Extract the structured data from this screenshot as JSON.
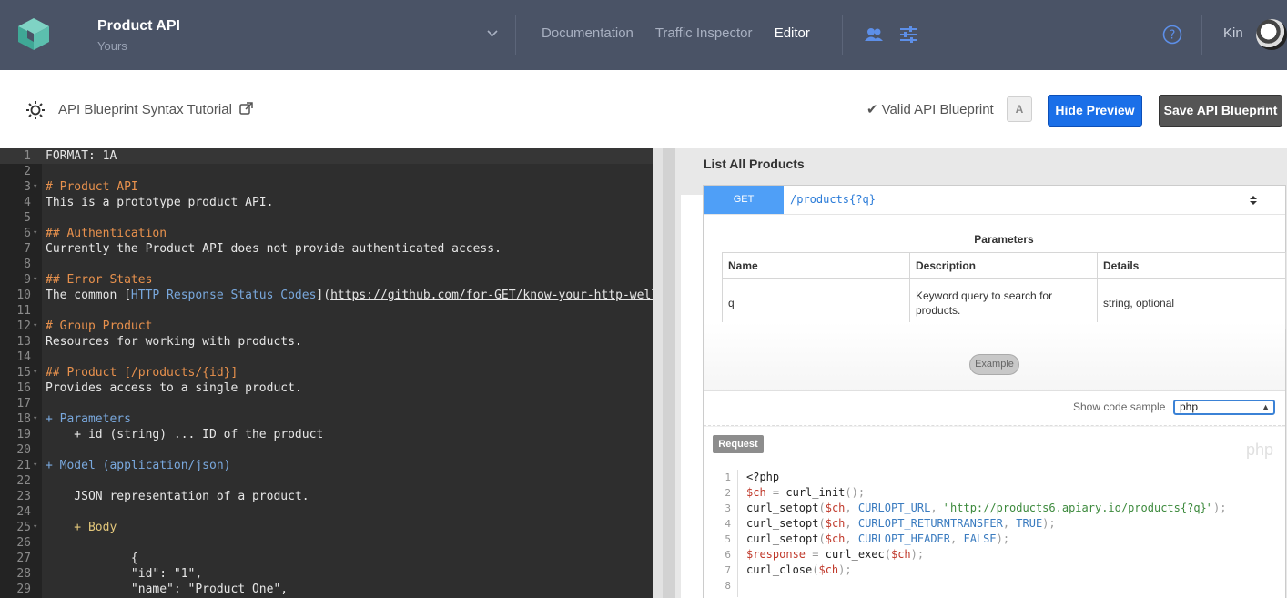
{
  "topnav": {
    "project_name": "Product API",
    "project_sub": "Yours",
    "links": [
      "Documentation",
      "Traffic Inspector",
      "Editor"
    ],
    "active_link": "Editor",
    "user_name": "Kin",
    "bg_color": "#4a5366"
  },
  "toolbar": {
    "tutorial_label": "API Blueprint Syntax Tutorial",
    "valid_label": "Valid API Blueprint",
    "a_label": "A",
    "hide_preview_label": "Hide Preview",
    "save_label": "Save API Blueprint",
    "primary_color": "#1a6fe8"
  },
  "editor": {
    "lines": [
      {
        "n": "1",
        "text": "FORMAT: 1A",
        "cls": ""
      },
      {
        "n": "2",
        "text": "",
        "cls": ""
      },
      {
        "n": "3",
        "text": "# Product API",
        "cls": "c-h",
        "fold": true
      },
      {
        "n": "4",
        "text": "This is a prototype product API.",
        "cls": ""
      },
      {
        "n": "5",
        "text": "",
        "cls": ""
      },
      {
        "n": "6",
        "text": "## Authentication",
        "cls": "c-h",
        "fold": true
      },
      {
        "n": "7",
        "text": "Currently the Product API does not provide authenticated access.",
        "cls": ""
      },
      {
        "n": "8",
        "text": "",
        "cls": ""
      },
      {
        "n": "9",
        "text": "## Error States",
        "cls": "c-h",
        "fold": true
      },
      {
        "n": "10",
        "text": "",
        "cls": "",
        "link": true
      },
      {
        "n": "11",
        "text": "",
        "cls": ""
      },
      {
        "n": "12",
        "text": "# Group Product",
        "cls": "c-h",
        "fold": true
      },
      {
        "n": "13",
        "text": "Resources for working with products.",
        "cls": ""
      },
      {
        "n": "14",
        "text": "",
        "cls": ""
      },
      {
        "n": "15",
        "text": "## Product [/products/{id}]",
        "cls": "c-h",
        "fold": true
      },
      {
        "n": "16",
        "text": "Provides access to a single product.",
        "cls": ""
      },
      {
        "n": "17",
        "text": "",
        "cls": ""
      },
      {
        "n": "18",
        "text": "+ Parameters",
        "cls": "c-b",
        "fold": true
      },
      {
        "n": "19",
        "text": "    + id (string) ... ID of the product",
        "cls": ""
      },
      {
        "n": "20",
        "text": "",
        "cls": ""
      },
      {
        "n": "21",
        "text": "+ Model (application/json)",
        "cls": "c-b",
        "fold": true
      },
      {
        "n": "22",
        "text": "",
        "cls": ""
      },
      {
        "n": "23",
        "text": "    JSON representation of a product.",
        "cls": ""
      },
      {
        "n": "24",
        "text": "",
        "cls": ""
      },
      {
        "n": "25",
        "text": "    + Body",
        "cls": "c-y",
        "fold": true
      },
      {
        "n": "26",
        "text": "",
        "cls": ""
      },
      {
        "n": "27",
        "text": "            {",
        "cls": ""
      },
      {
        "n": "28",
        "text": "            \"id\": \"1\",",
        "cls": ""
      },
      {
        "n": "29",
        "text": "            \"name\": \"Product One\",",
        "cls": ""
      }
    ],
    "line10": {
      "prefix": "The common [",
      "link_text": "HTTP Response Status Codes",
      "mid": "](",
      "url": "https://github.com/for-GET/know-your-http-well"
    }
  },
  "preview": {
    "title": "List All Products",
    "method": "GET",
    "path": "/products{?q}",
    "params_heading": "Parameters",
    "params_columns": [
      "Name",
      "Description",
      "Details"
    ],
    "params_rows": [
      [
        "q",
        "Keyword query to search for products.",
        "string, optional"
      ]
    ],
    "example_label": "Example",
    "sample_label": "Show code sample",
    "sample_value": "php",
    "request_label": "Request",
    "lang_watermark": "php",
    "method_color": "#4f9ff7"
  },
  "snippet": {
    "line_numbers": [
      "1",
      "2",
      "3",
      "4",
      "5",
      "6",
      "7",
      "8"
    ],
    "l1": "<?php",
    "l2_var": "$ch",
    "l2_op": " = ",
    "l2_fn": "curl_init",
    "l2_p": "();",
    "l3_fn": "curl_setopt",
    "l3_const": "CURLOPT_URL",
    "l3_str": "\"http://products6.apiary.io/products{?q}\"",
    "l4_const": "CURLOPT_RETURNTRANSFER",
    "l4_val": "TRUE",
    "l5_const": "CURLOPT_HEADER",
    "l5_val": "FALSE",
    "l6_var": "$response",
    "l6_fn": "curl_exec",
    "l7_fn": "curl_close"
  }
}
